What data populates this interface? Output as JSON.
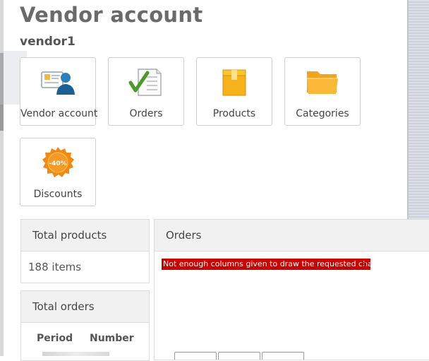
{
  "page": {
    "title": "Vendor account",
    "vendor_name": "vendor1"
  },
  "tiles": [
    {
      "label": "Vendor account",
      "icon": "vendor-account-icon"
    },
    {
      "label": "Orders",
      "icon": "orders-checklist-icon"
    },
    {
      "label": "Products",
      "icon": "products-box-icon"
    },
    {
      "label": "Categories",
      "icon": "categories-folder-icon"
    },
    {
      "label": "Discounts",
      "icon": "discount-badge-icon",
      "badge_text": "-40%"
    }
  ],
  "total_products": {
    "header": "Total products",
    "value": "188 items"
  },
  "total_orders": {
    "header": "Total orders",
    "columns": [
      "Period",
      "Number"
    ]
  },
  "orders_panel": {
    "header": "Orders",
    "error_message": "Not enough columns given to draw the requested chart.",
    "error_close": "×"
  },
  "colors": {
    "error_bg": "#c80000",
    "panel_header_bg": "#f1f1f1",
    "title": "#6a6a6a"
  }
}
